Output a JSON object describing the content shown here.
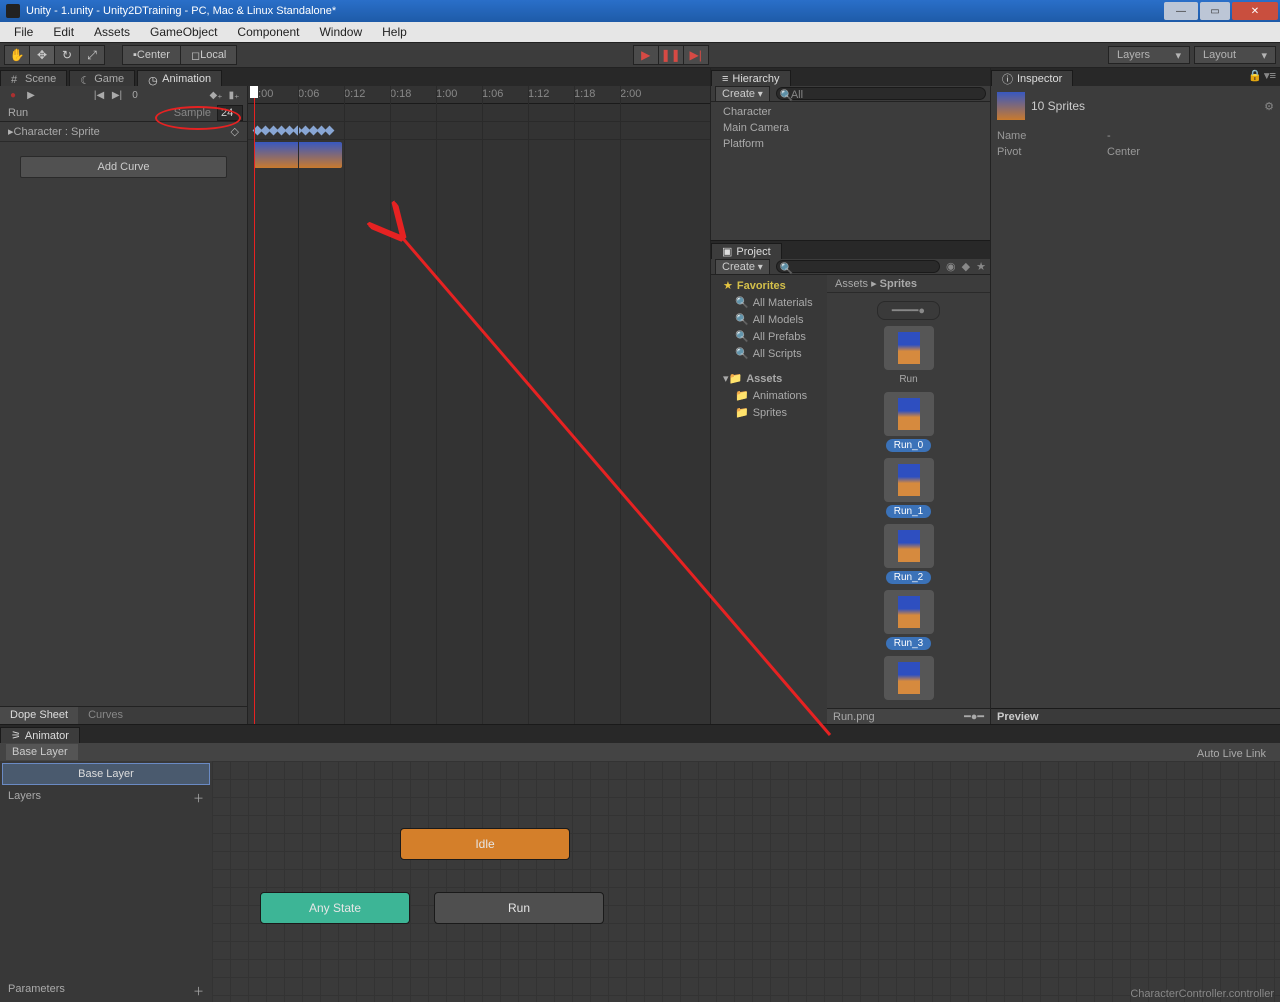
{
  "window": {
    "title": "Unity - 1.unity - Unity2DTraining - PC, Mac & Linux Standalone*"
  },
  "menu": [
    "File",
    "Edit",
    "Assets",
    "GameObject",
    "Component",
    "Window",
    "Help"
  ],
  "toolbar": {
    "center": "Center",
    "local": "Local",
    "layers": "Layers",
    "layout": "Layout"
  },
  "tabs": {
    "scene": "Scene",
    "game": "Game",
    "animation": "Animation"
  },
  "animation": {
    "frame": "0",
    "clip": "Run",
    "sample_label": "Sample",
    "sample_value": "24",
    "property": "Character : Sprite",
    "add_curve": "Add Curve",
    "dope": "Dope Sheet",
    "curves": "Curves",
    "ruler": [
      "0:00",
      "0:06",
      "0:12",
      "0:18",
      "1:00",
      "1:06",
      "1:12",
      "1:18",
      "2:00"
    ]
  },
  "animator": {
    "tab": "Animator",
    "breadcrumb": "Base Layer",
    "layer_item": "Base Layer",
    "layers_label": "Layers",
    "params_label": "Parameters",
    "auto_live": "Auto Live Link",
    "idle": "Idle",
    "any_state": "Any State",
    "run": "Run",
    "controller_path": "CharacterController.controller"
  },
  "hierarchy": {
    "title": "Hierarchy",
    "create": "Create",
    "search_ph": "All",
    "items": [
      "Character",
      "Main Camera",
      "Platform"
    ]
  },
  "project": {
    "title": "Project",
    "create": "Create",
    "favorites": "Favorites",
    "fav_items": [
      "All Materials",
      "All Models",
      "All Prefabs",
      "All Scripts"
    ],
    "assets": "Assets",
    "asset_items": [
      "Animations",
      "Sprites"
    ],
    "breadcrumb_a": "Assets",
    "breadcrumb_b": "Sprites",
    "run_folder": "Run",
    "items": [
      "Run_0",
      "Run_1",
      "Run_2",
      "Run_3"
    ],
    "footer_file": "Run.png"
  },
  "inspector": {
    "title": "Inspector",
    "selection": "10 Sprites",
    "name_k": "Name",
    "name_v": "-",
    "pivot_k": "Pivot",
    "pivot_v": "Center",
    "preview": "Preview"
  }
}
